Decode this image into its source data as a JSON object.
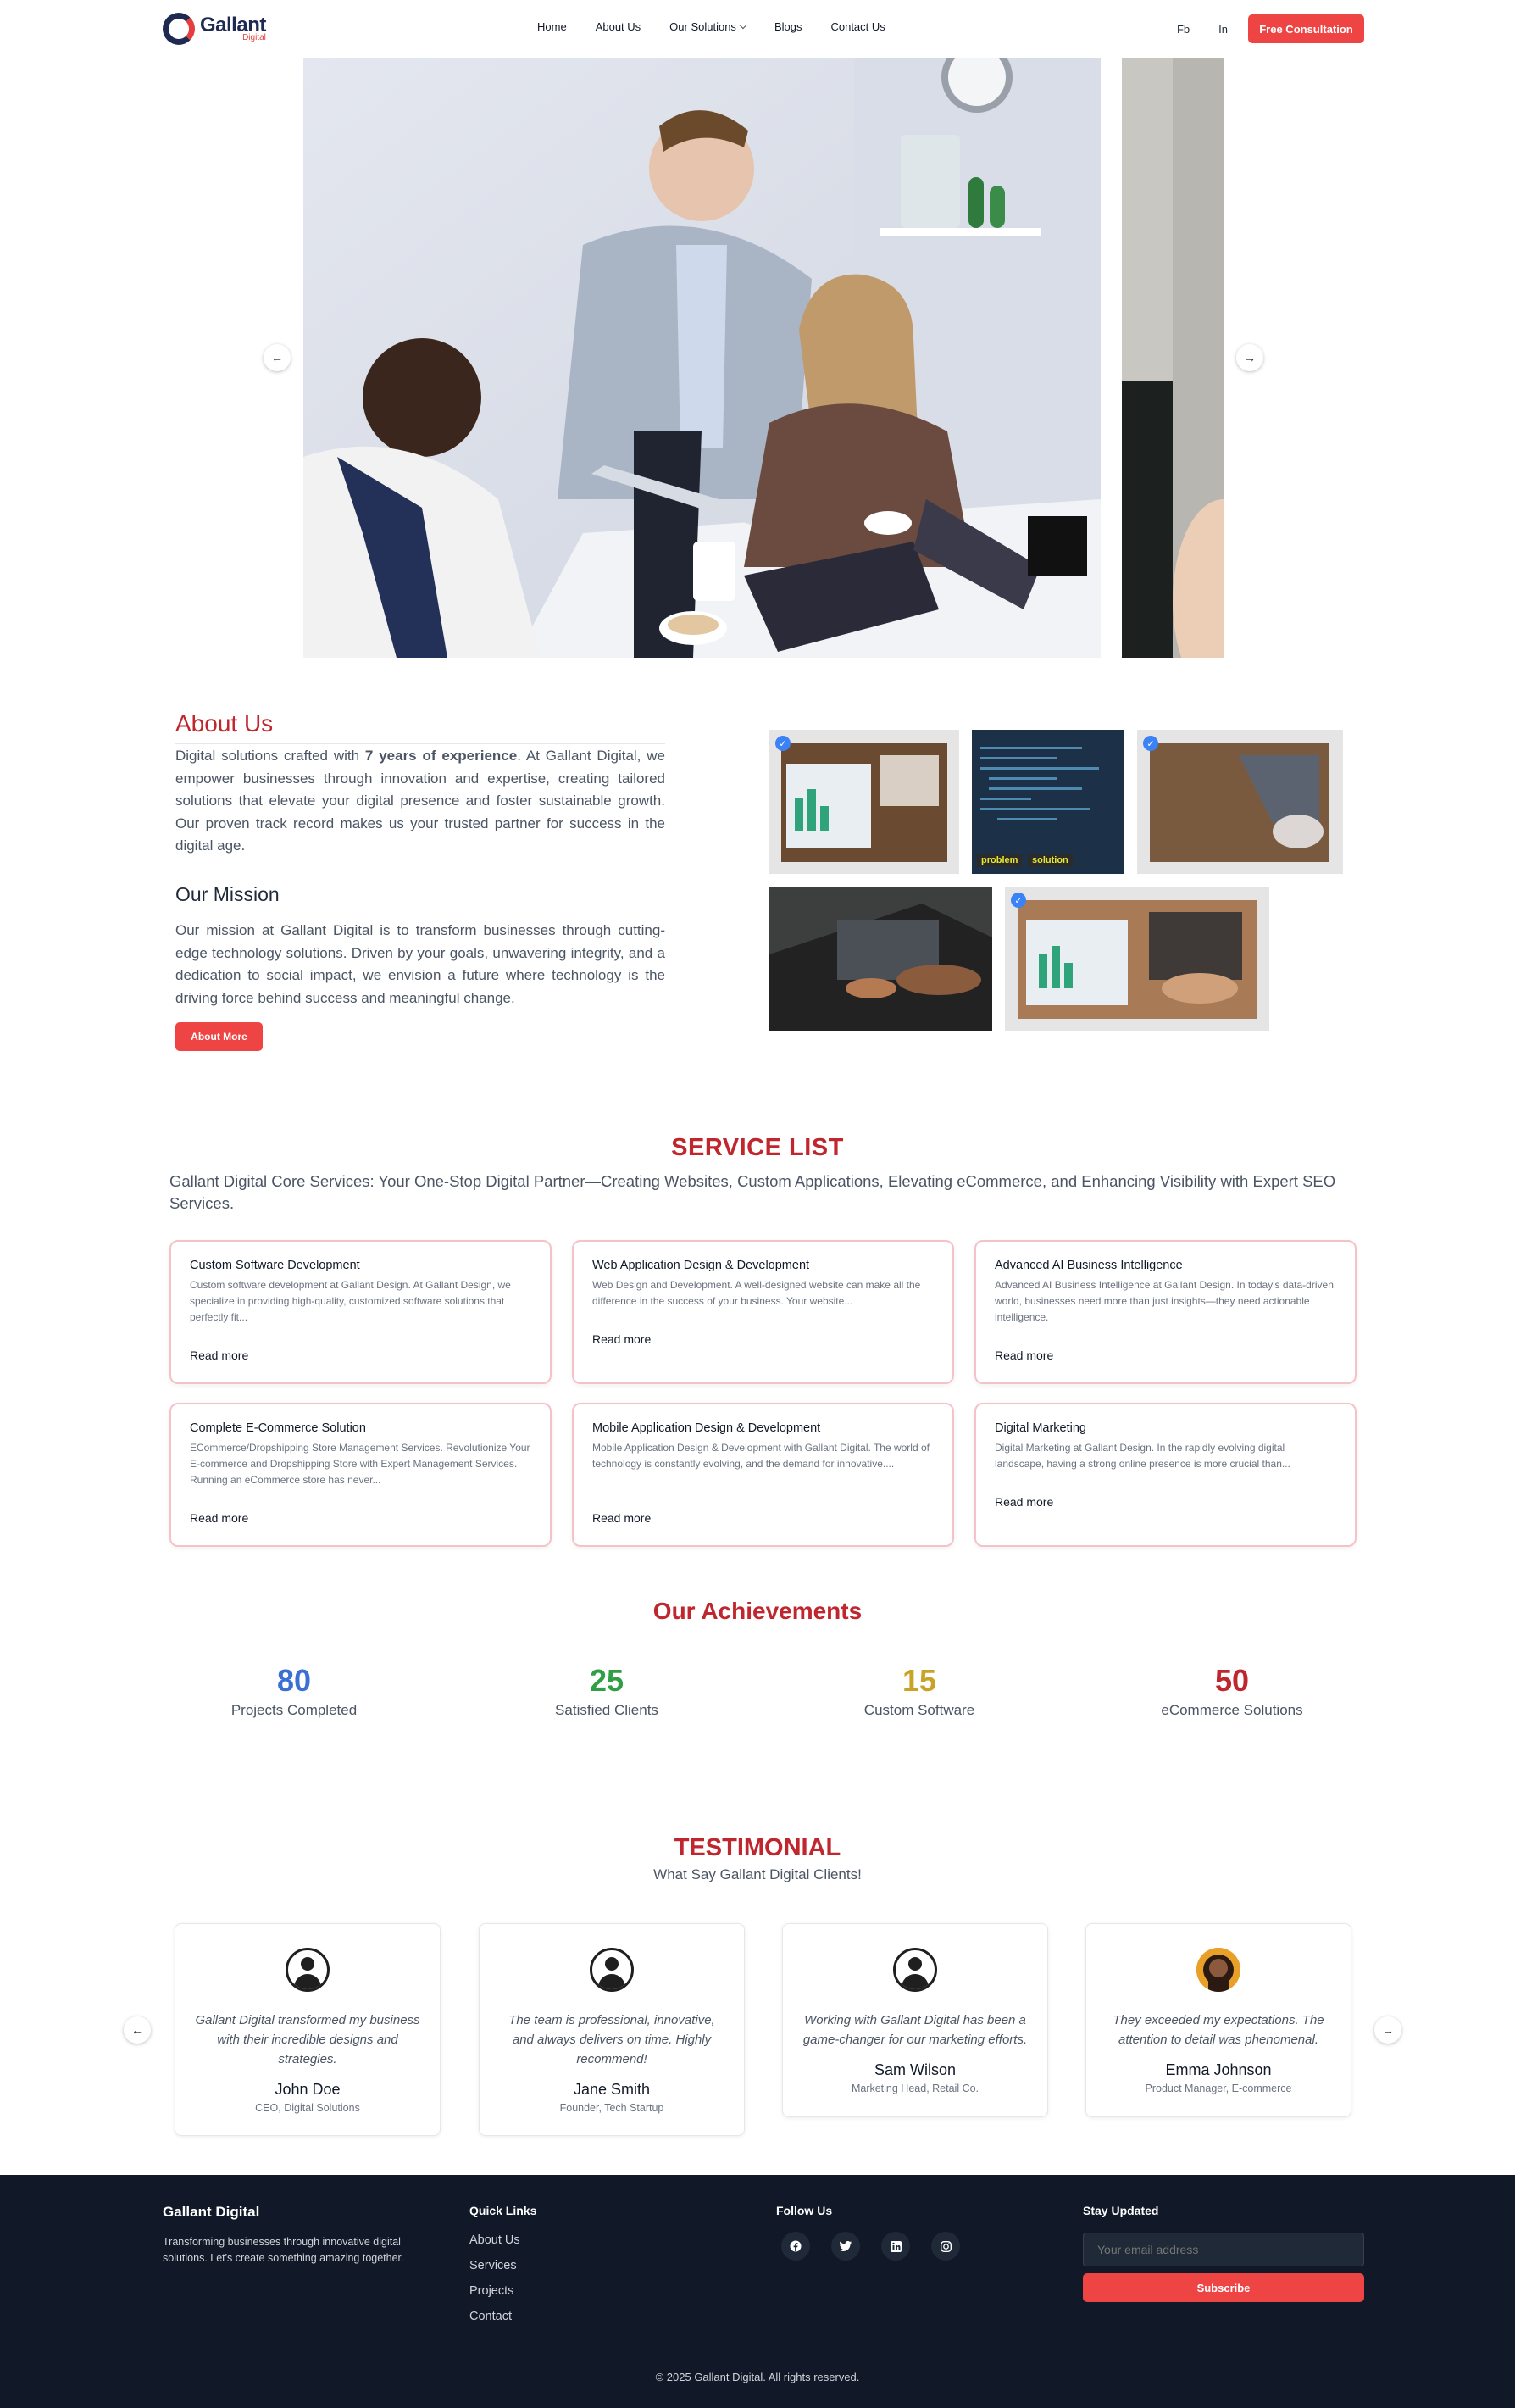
{
  "brand": {
    "name": "Gallant",
    "sub": "Digital"
  },
  "nav": {
    "items": [
      "Home",
      "About Us",
      "Our Solutions",
      "Blogs",
      "Contact Us"
    ],
    "fb": "Fb",
    "in": "In",
    "cta": "Free Consultation"
  },
  "about": {
    "title": "About Us",
    "p_before": "Digital solutions crafted with ",
    "p_bold": "7 years of experience",
    "p_after": ". At Gallant Digital, we empower businesses through innovation and expertise, creating tailored solutions that elevate your digital presence and foster sustainable growth. Our proven track record makes us your trusted partner for success in the digital age.",
    "mission_title": "Our Mission",
    "mission_text": "Our mission at Gallant Digital is to transform businesses through cutting-edge technology solutions. Driven by your goals, unwavering integrity, and a dedication to social impact, we envision a future where technology is the driving force behind success and meaningful change.",
    "button": "About More",
    "tags": [
      "problem",
      "solution"
    ]
  },
  "services": {
    "title": "SERVICE LIST",
    "subtitle": "Gallant Digital Core Services: Your One-Stop Digital Partner—Creating Websites, Custom Applications, Elevating eCommerce, and Enhancing Visibility with Expert SEO Services.",
    "read_more": "Read more",
    "items": [
      {
        "title": "Custom Software Development",
        "desc": "Custom software development at Gallant Design. At Gallant Design, we specialize in providing high-quality, customized software solutions that perfectly fit..."
      },
      {
        "title": "Web Application Design & Development",
        "desc": "Web Design and Development. A well-designed website can make all the difference in the success of your business. Your website..."
      },
      {
        "title": "Advanced AI Business Intelligence",
        "desc": "Advanced AI Business Intelligence at Gallant Design. In today's data-driven world, businesses need more than just insights—they need actionable intelligence."
      },
      {
        "title": "Complete E-Commerce Solution",
        "desc": "ECommerce/Dropshipping Store Management Services. Revolutionize Your E-commerce and Dropshipping Store with Expert Management Services. Running an eCommerce store has never..."
      },
      {
        "title": "Mobile Application Design & Development",
        "desc": "Mobile Application Design & Development with Gallant Digital. The world of technology is constantly evolving, and the demand for innovative...."
      },
      {
        "title": "Digital Marketing",
        "desc": "Digital Marketing at Gallant Design. In the rapidly evolving digital landscape, having a strong online presence is more crucial than..."
      }
    ]
  },
  "achievements": {
    "title": "Our Achievements",
    "stats": [
      {
        "value": "80",
        "label": "Projects Completed",
        "color": "#3b6fd4"
      },
      {
        "value": "25",
        "label": "Satisfied Clients",
        "color": "#2f9e44"
      },
      {
        "value": "15",
        "label": "Custom Software",
        "color": "#c9a227"
      },
      {
        "value": "50",
        "label": "eCommerce Solutions",
        "color": "#c0262d"
      }
    ]
  },
  "testimonials": {
    "title": "TESTIMONIAL",
    "subtitle": "What Say Gallant Digital Clients!",
    "items": [
      {
        "quote": "Gallant Digital transformed my business with their incredible designs and strategies.",
        "name": "John Doe",
        "role": "CEO, Digital Solutions"
      },
      {
        "quote": "The team is professional, innovative, and always delivers on time. Highly recommend!",
        "name": "Jane Smith",
        "role": "Founder, Tech Startup"
      },
      {
        "quote": "Working with Gallant Digital has been a game-changer for our marketing efforts.",
        "name": "Sam Wilson",
        "role": "Marketing Head, Retail Co."
      },
      {
        "quote": "They exceeded my expectations. The attention to detail was phenomenal.",
        "name": "Emma Johnson",
        "role": "Product Manager, E-commerce"
      }
    ]
  },
  "footer": {
    "brand": "Gallant Digital",
    "desc": "Transforming businesses through innovative digital solutions. Let's create something amazing together.",
    "quick_links_title": "Quick Links",
    "links": [
      "About Us",
      "Services",
      "Projects",
      "Contact"
    ],
    "follow_title": "Follow Us",
    "social_icons": [
      "facebook-icon",
      "twitter-icon",
      "linkedin-icon",
      "instagram-icon"
    ],
    "updated_title": "Stay Updated",
    "email_placeholder": "Your email address",
    "subscribe": "Subscribe",
    "copyright": "© 2025 Gallant Digital. All rights reserved."
  }
}
